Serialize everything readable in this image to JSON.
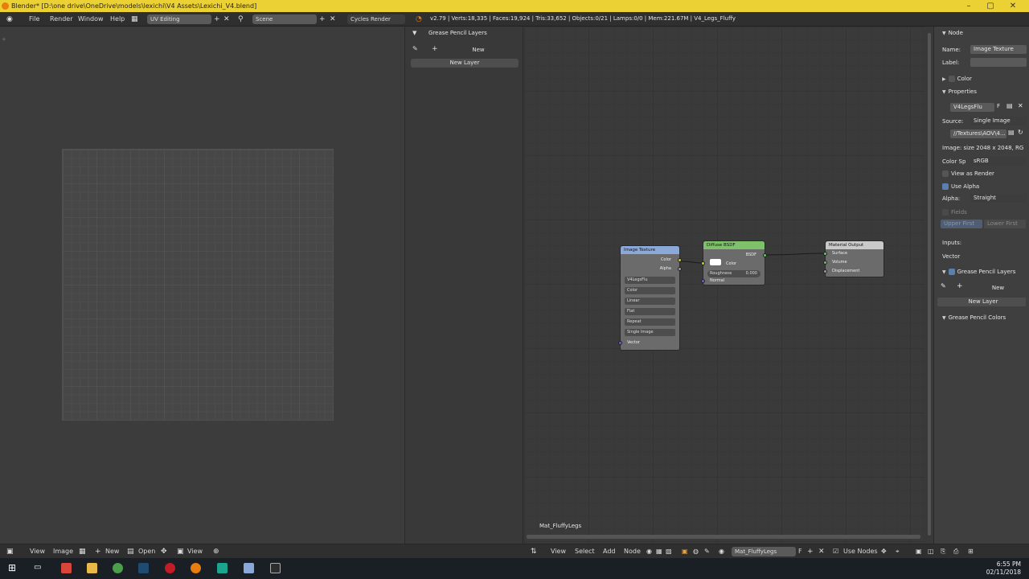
{
  "window": {
    "title": "Blender* [D:\\one drive\\OneDrive\\models\\lexichi\\V4 Assets\\Lexichi_V4.blend]"
  },
  "info_header": {
    "menus": [
      "File",
      "Render",
      "Window",
      "Help"
    ],
    "screen_layout": "UV Editing",
    "scene": "Scene",
    "render_engine": "Cycles Render",
    "stats": "v2.79 | Verts:18,335 | Faces:19,924 | Tris:33,652 | Objects:0/21 | Lamps:0/0 | Mem:221.67M | V4_Legs_Fluffy"
  },
  "gp_panel": {
    "title": "Grease Pencil Layers",
    "new_label": "New",
    "new_layer_label": "New Layer"
  },
  "node_editor": {
    "material_name": "Mat_FluffyLegs",
    "image_texture_node": {
      "title": "Image Texture",
      "outputs": [
        "Color",
        "Alpha"
      ],
      "image_field": "V4LegsFlu",
      "rows": [
        "Color",
        "Linear",
        "Flat",
        "Repeat",
        "Single Image"
      ],
      "input": "Vector",
      "header_color": "#8aa9d8"
    },
    "diffuse_node": {
      "title": "Diffuse BSDF",
      "output": "BSDF",
      "color_label": "Color",
      "roughness_label": "Roughness",
      "roughness_value": "0.000",
      "normal_label": "Normal",
      "header_color": "#7fc16b"
    },
    "output_node": {
      "title": "Material Output",
      "inputs": [
        "Surface",
        "Volume",
        "Displacement"
      ],
      "header_color": "#c9c9c9"
    }
  },
  "properties": {
    "node_section": "Node",
    "name_label": "Name:",
    "name_value": "Image Texture",
    "label_label": "Label:",
    "label_value": "",
    "color_section": "Color",
    "properties_section": "Properties",
    "image_name": "V4LegsFlu",
    "fake_user": "F",
    "source_label": "Source:",
    "source_value": "Single Image",
    "filepath": "//Textures\\AOV\\4...",
    "image_size": "Image: size 2048 x 2048, RG",
    "color_space_label": "Color Sp",
    "color_space_value": "sRGB",
    "view_as_render": "View as Render",
    "use_alpha": "Use Alpha",
    "alpha_label": "Alpha:",
    "alpha_value": "Straight",
    "fields": "Fields",
    "upper_first": "Upper First",
    "lower_first": "Lower First",
    "inputs_label": "Inputs:",
    "vector_label": "Vector",
    "gp_layers_section": "Grease Pencil Layers",
    "gp_new": "New",
    "gp_new_layer": "New Layer",
    "gp_colors_section": "Grease Pencil Colors"
  },
  "uv_footer": {
    "menus": [
      "View",
      "Image"
    ],
    "new_label": "New",
    "open_label": "Open",
    "view_label": "View"
  },
  "node_footer": {
    "menus": [
      "View",
      "Select",
      "Add",
      "Node"
    ],
    "material_field": "Mat_FluffyLegs",
    "fake_user": "F",
    "use_nodes": "Use Nodes"
  },
  "taskbar": {
    "time": "6:55 PM",
    "date": "02/11/2018"
  }
}
